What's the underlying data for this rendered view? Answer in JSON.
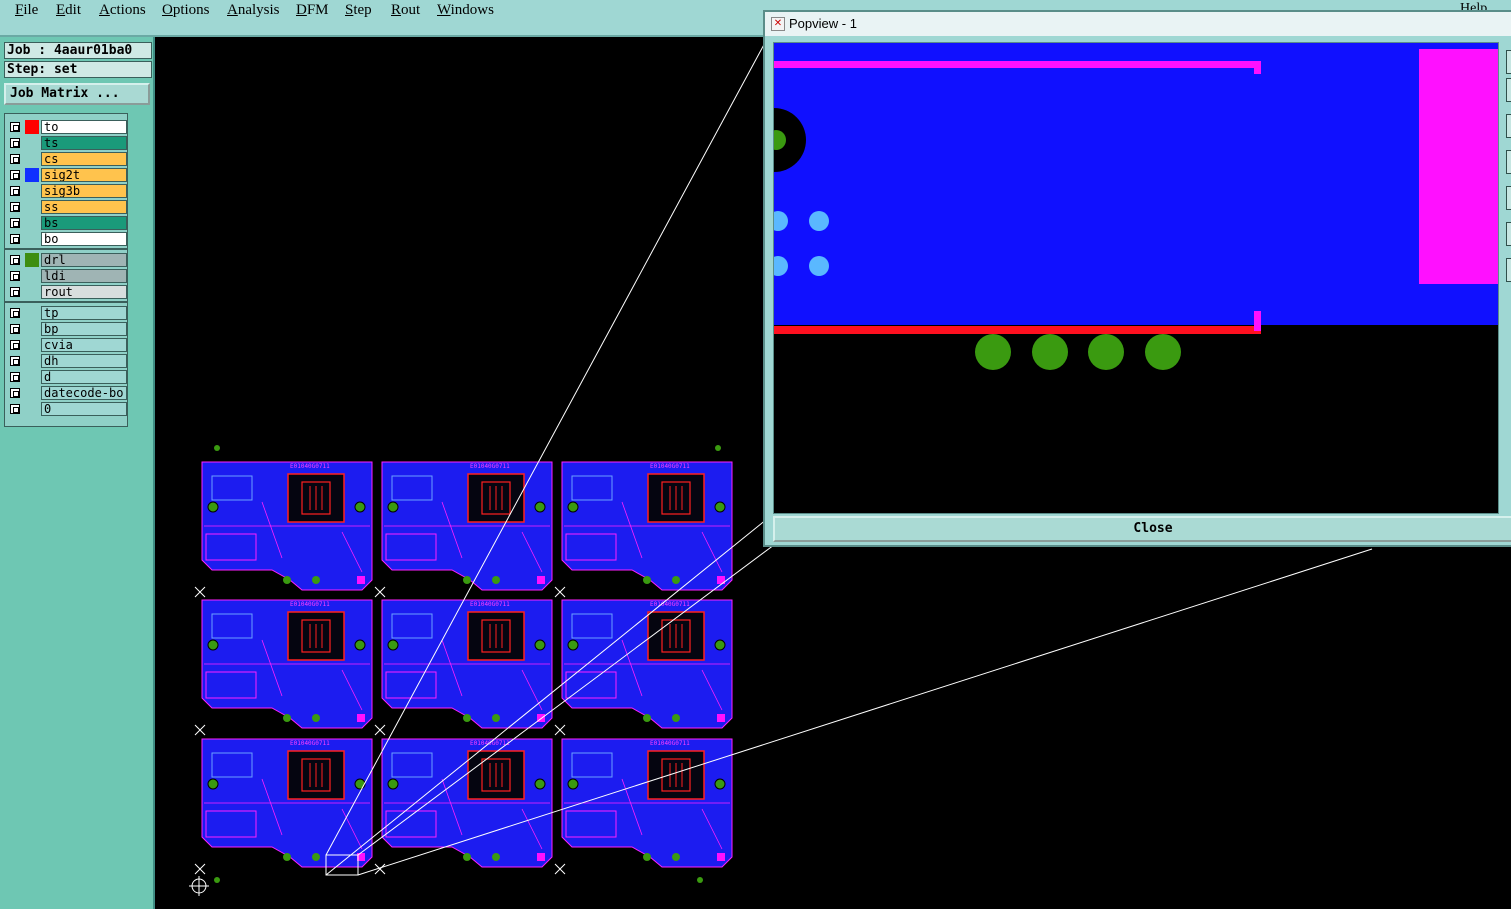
{
  "menu": {
    "items": [
      "File",
      "Edit",
      "Actions",
      "Options",
      "Analysis",
      "DFM",
      "Step",
      "Rout",
      "Windows"
    ],
    "help": "Help"
  },
  "info": {
    "job": "Job : 4aaur01ba0",
    "step": "Step: set"
  },
  "job_matrix_label": "Job Matrix ...",
  "layers": [
    {
      "name": "to",
      "color": "#ffffff",
      "swatch": "#ff0000"
    },
    {
      "name": "ts",
      "color": "#1a9a7a",
      "swatch": ""
    },
    {
      "name": "cs",
      "color": "#ffc34d",
      "swatch": ""
    },
    {
      "name": "sig2t",
      "color": "#ffc34d",
      "swatch": "#1030ff"
    },
    {
      "name": "sig3b",
      "color": "#ffc34d",
      "swatch": ""
    },
    {
      "name": "ss",
      "color": "#ffc34d",
      "swatch": ""
    },
    {
      "name": "bs",
      "color": "#1a9a7a",
      "swatch": ""
    },
    {
      "name": "bo",
      "color": "#ffffff",
      "swatch": ""
    },
    {
      "name": "drl",
      "color": "#9fb4b4",
      "swatch": "#3e8e10"
    },
    {
      "name": "ldi",
      "color": "#9fb4b4",
      "swatch": ""
    },
    {
      "name": "rout",
      "color": "#d8dede",
      "swatch": ""
    },
    {
      "name": "tp",
      "color": "#9fd7d3",
      "swatch": ""
    },
    {
      "name": "bp",
      "color": "#9fd7d3",
      "swatch": ""
    },
    {
      "name": "cvia",
      "color": "#9fd7d3",
      "swatch": ""
    },
    {
      "name": "dh",
      "color": "#9fd7d3",
      "swatch": ""
    },
    {
      "name": "d",
      "color": "#9fd7d3",
      "swatch": ""
    },
    {
      "name": "datecode-bo",
      "color": "#9fd7d3",
      "swatch": ""
    },
    {
      "name": "0",
      "color": "#9fd7d3",
      "swatch": ""
    }
  ],
  "popview": {
    "title": "Popview - 1",
    "close_label": "Close"
  },
  "board_text": "E01040G0711"
}
